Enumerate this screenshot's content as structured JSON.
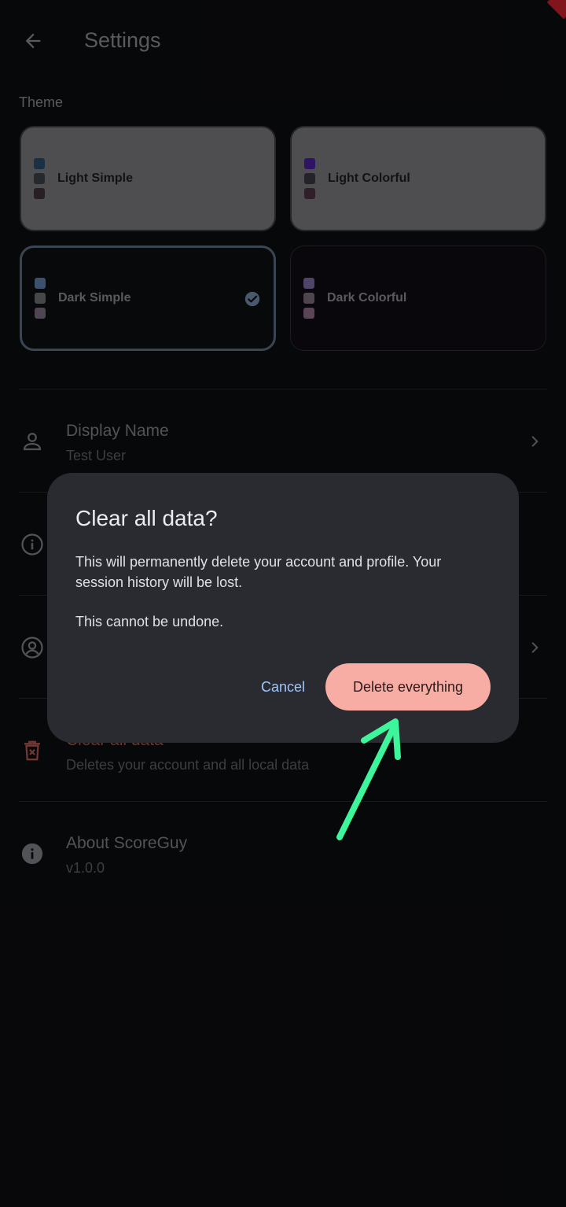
{
  "appbar": {
    "title": "Settings"
  },
  "theme_section": {
    "label": "Theme",
    "cards": [
      {
        "label": "Light Simple",
        "dots": [
          "#2a4a6b",
          "#3a3e45",
          "#3c3038"
        ]
      },
      {
        "label": "Light Colorful",
        "dots": [
          "#4a1f9a",
          "#3a3640",
          "#4a3040"
        ]
      },
      {
        "label": "Dark Simple",
        "dots": [
          "#5d7ea6",
          "#6a6d73",
          "#7c6a80"
        ],
        "selected": true
      },
      {
        "label": "Dark Colorful",
        "dots": [
          "#7a6aa0",
          "#7a6a78",
          "#8a6a88"
        ]
      }
    ]
  },
  "settings": {
    "display_name": {
      "title": "Display Name",
      "subtitle": "Test User"
    },
    "clear_data": {
      "title": "Clear all data",
      "subtitle": "Deletes your account and all local data"
    },
    "about": {
      "title": "About ScoreGuy",
      "subtitle": "v1.0.0"
    }
  },
  "dialog": {
    "title": "Clear all data?",
    "body1": "This will permanently delete your account and profile. Your session history will be lost.",
    "body2": "This cannot be undone.",
    "cancel_label": "Cancel",
    "confirm_label": "Delete everything"
  },
  "colors": {
    "accent": "#f7ada3",
    "cancel_text": "#9fc6ff",
    "annotation_arrow": "#3df59a",
    "danger_icon": "#b0574e"
  }
}
